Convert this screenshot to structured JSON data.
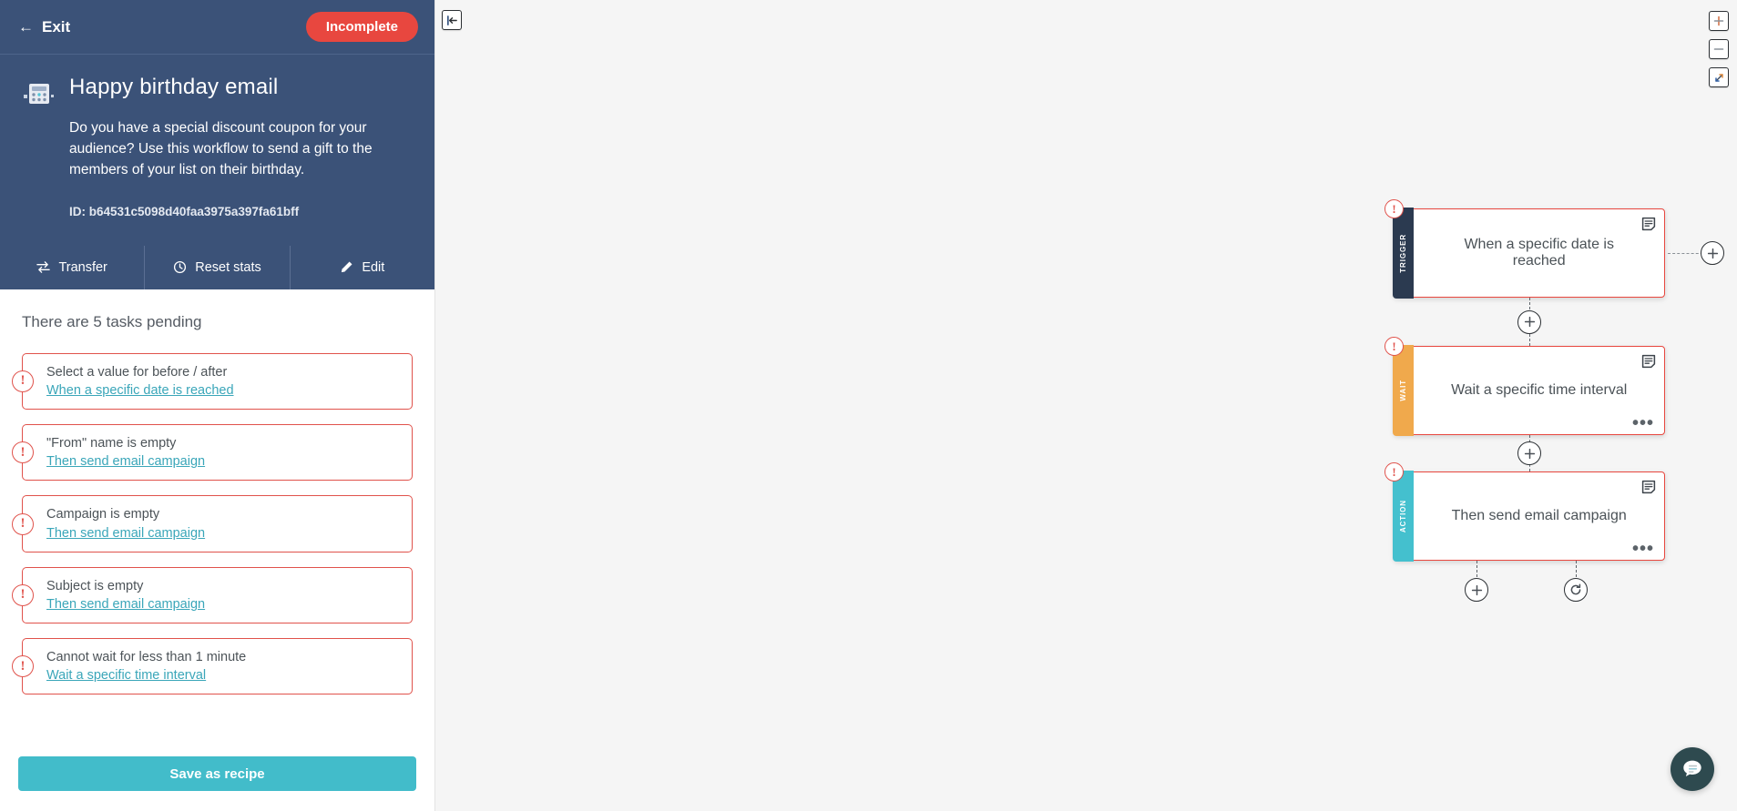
{
  "sidebar": {
    "exit_label": "Exit",
    "status_badge": "Incomplete",
    "workflow_title": "Happy birthday email",
    "workflow_description": "Do you have a special discount coupon for your audience? Use this workflow to send a gift to the members of your list on their birthday.",
    "workflow_id": "ID: b64531c5098d40faa3975a397fa61bff",
    "actions": [
      {
        "label": "Transfer",
        "icon": "transfer-icon"
      },
      {
        "label": "Reset stats",
        "icon": "clock-reset-icon"
      },
      {
        "label": "Edit",
        "icon": "pencil-icon"
      }
    ],
    "tasks_heading": "There are 5 tasks pending",
    "tasks": [
      {
        "message": "Select a value for before / after",
        "link": "When a specific date is reached"
      },
      {
        "message": "\"From\" name is empty",
        "link": "Then send email campaign"
      },
      {
        "message": "Campaign is empty",
        "link": "Then send email campaign"
      },
      {
        "message": "Subject is empty",
        "link": "Then send email campaign"
      },
      {
        "message": "Cannot wait for less than 1 minute",
        "link": "Wait a specific time interval"
      }
    ],
    "save_label": "Save as recipe"
  },
  "canvas": {
    "collapse_icon": "collapse-left-icon",
    "zoom_in_icon": "plus-icon",
    "zoom_out_icon": "minus-icon",
    "fit_icon": "expand-diagonal-icon",
    "alert_glyph": "!",
    "menu_glyph": "•••",
    "nodes": [
      {
        "type_label": "TRIGGER",
        "title": "When a specific date is reached",
        "color": "#2b3a50",
        "has_menu": false
      },
      {
        "type_label": "WAIT",
        "title": "Wait a specific time interval",
        "color": "#f0a94c",
        "has_menu": true
      },
      {
        "type_label": "ACTION",
        "title": "Then send email campaign",
        "color": "#44c0ce",
        "has_menu": true
      }
    ],
    "connectors": [
      {
        "name": "branch-add-button",
        "icon": "plus-icon"
      },
      {
        "name": "add-step-button-1",
        "icon": "plus-icon"
      },
      {
        "name": "add-step-button-2",
        "icon": "plus-icon"
      },
      {
        "name": "add-step-button-3",
        "icon": "plus-icon"
      },
      {
        "name": "loop-step-button",
        "icon": "loop-icon"
      }
    ],
    "chat_icon": "chat-bubble-icon"
  },
  "colors": {
    "sidebar_bg": "#3b5278",
    "danger": "#e8473f",
    "accent_teal": "#42bcca",
    "link": "#3aa6b9"
  }
}
